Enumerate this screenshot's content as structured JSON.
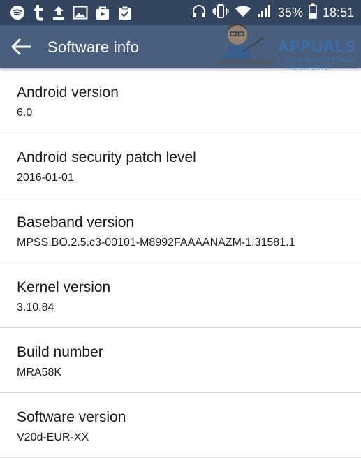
{
  "status_bar": {
    "left_icons": [
      "spotify-icon",
      "tumblr-icon",
      "upload-icon",
      "image-icon",
      "bag-icon",
      "clipboard-check-icon"
    ],
    "right_icons": [
      "headphones-icon",
      "vibrate-icon",
      "wifi-icon",
      "signal-icon",
      "battery-icon"
    ],
    "battery": "35%",
    "time": "18:51"
  },
  "app_bar": {
    "title": "Software info",
    "back_icon": "arrow-back-icon"
  },
  "watermark": {
    "brand": "APPUALS",
    "tagline_1": "TECH HOW-TO'S FROM",
    "tagline_2": "THE EXPERTS!"
  },
  "items": [
    {
      "title": "Android version",
      "value": "6.0"
    },
    {
      "title": "Android security patch level",
      "value": "2016-01-01"
    },
    {
      "title": "Baseband version",
      "value": "MPSS.BO.2.5.c3-00101-M8992FAAAANAZM-1.31581.1"
    },
    {
      "title": "Kernel version",
      "value": "3.10.84"
    },
    {
      "title": "Build number",
      "value": "MRA58K"
    },
    {
      "title": "Software version",
      "value": "V20d-EUR-XX"
    }
  ],
  "colors": {
    "status_bar": "#34465f",
    "app_bar": "#4a5f7e",
    "divider": "#dcdcdc"
  }
}
